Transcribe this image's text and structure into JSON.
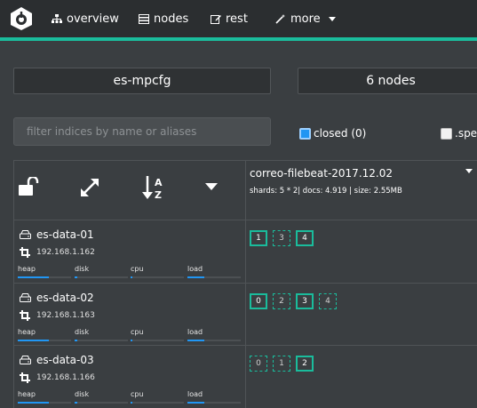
{
  "nav": {
    "items": [
      {
        "label": "overview",
        "icon": "sitemap-icon"
      },
      {
        "label": "nodes",
        "icon": "server-icon"
      },
      {
        "label": "rest",
        "icon": "edit-icon"
      },
      {
        "label": "more",
        "icon": "magic-wand-icon"
      }
    ],
    "accent_color": "#1abc9c"
  },
  "cluster": {
    "name": "es-mpcfg",
    "nodes_count": "6 nodes"
  },
  "filter": {
    "placeholder": "filter indices by name or aliases",
    "closed_label": "closed (0)",
    "closed_checked": true,
    "special_label": ".spe",
    "special_checked": false
  },
  "index": {
    "name": "correo-filebeat-2017.12.02",
    "meta": "shards: 5 * 2| docs: 4.919 | size: 2.55MB"
  },
  "metric_labels": [
    "heap",
    "disk",
    "cpu",
    "load"
  ],
  "nodes": [
    {
      "name": "es-data-01",
      "ip": "192.168.1.162",
      "usage": {
        "heap": 0.58,
        "disk": 0.05,
        "cpu": 0.04,
        "load": 0.32
      },
      "shards": [
        {
          "label": "1",
          "type": "primary"
        },
        {
          "label": "3",
          "type": "replica"
        },
        {
          "label": "4",
          "type": "primary"
        }
      ]
    },
    {
      "name": "es-data-02",
      "ip": "192.168.1.163",
      "usage": {
        "heap": 0.58,
        "disk": 0.05,
        "cpu": 0.04,
        "load": 0.32
      },
      "shards": [
        {
          "label": "0",
          "type": "primary"
        },
        {
          "label": "2",
          "type": "replica"
        },
        {
          "label": "3",
          "type": "primary"
        },
        {
          "label": "4",
          "type": "replica"
        }
      ]
    },
    {
      "name": "es-data-03",
      "ip": "192.168.1.166",
      "usage": {
        "heap": 0.58,
        "disk": 0.05,
        "cpu": 0.04,
        "load": 0.32
      },
      "shards": [
        {
          "label": "0",
          "type": "replica"
        },
        {
          "label": "1",
          "type": "replica"
        },
        {
          "label": "2",
          "type": "primary"
        }
      ]
    }
  ]
}
